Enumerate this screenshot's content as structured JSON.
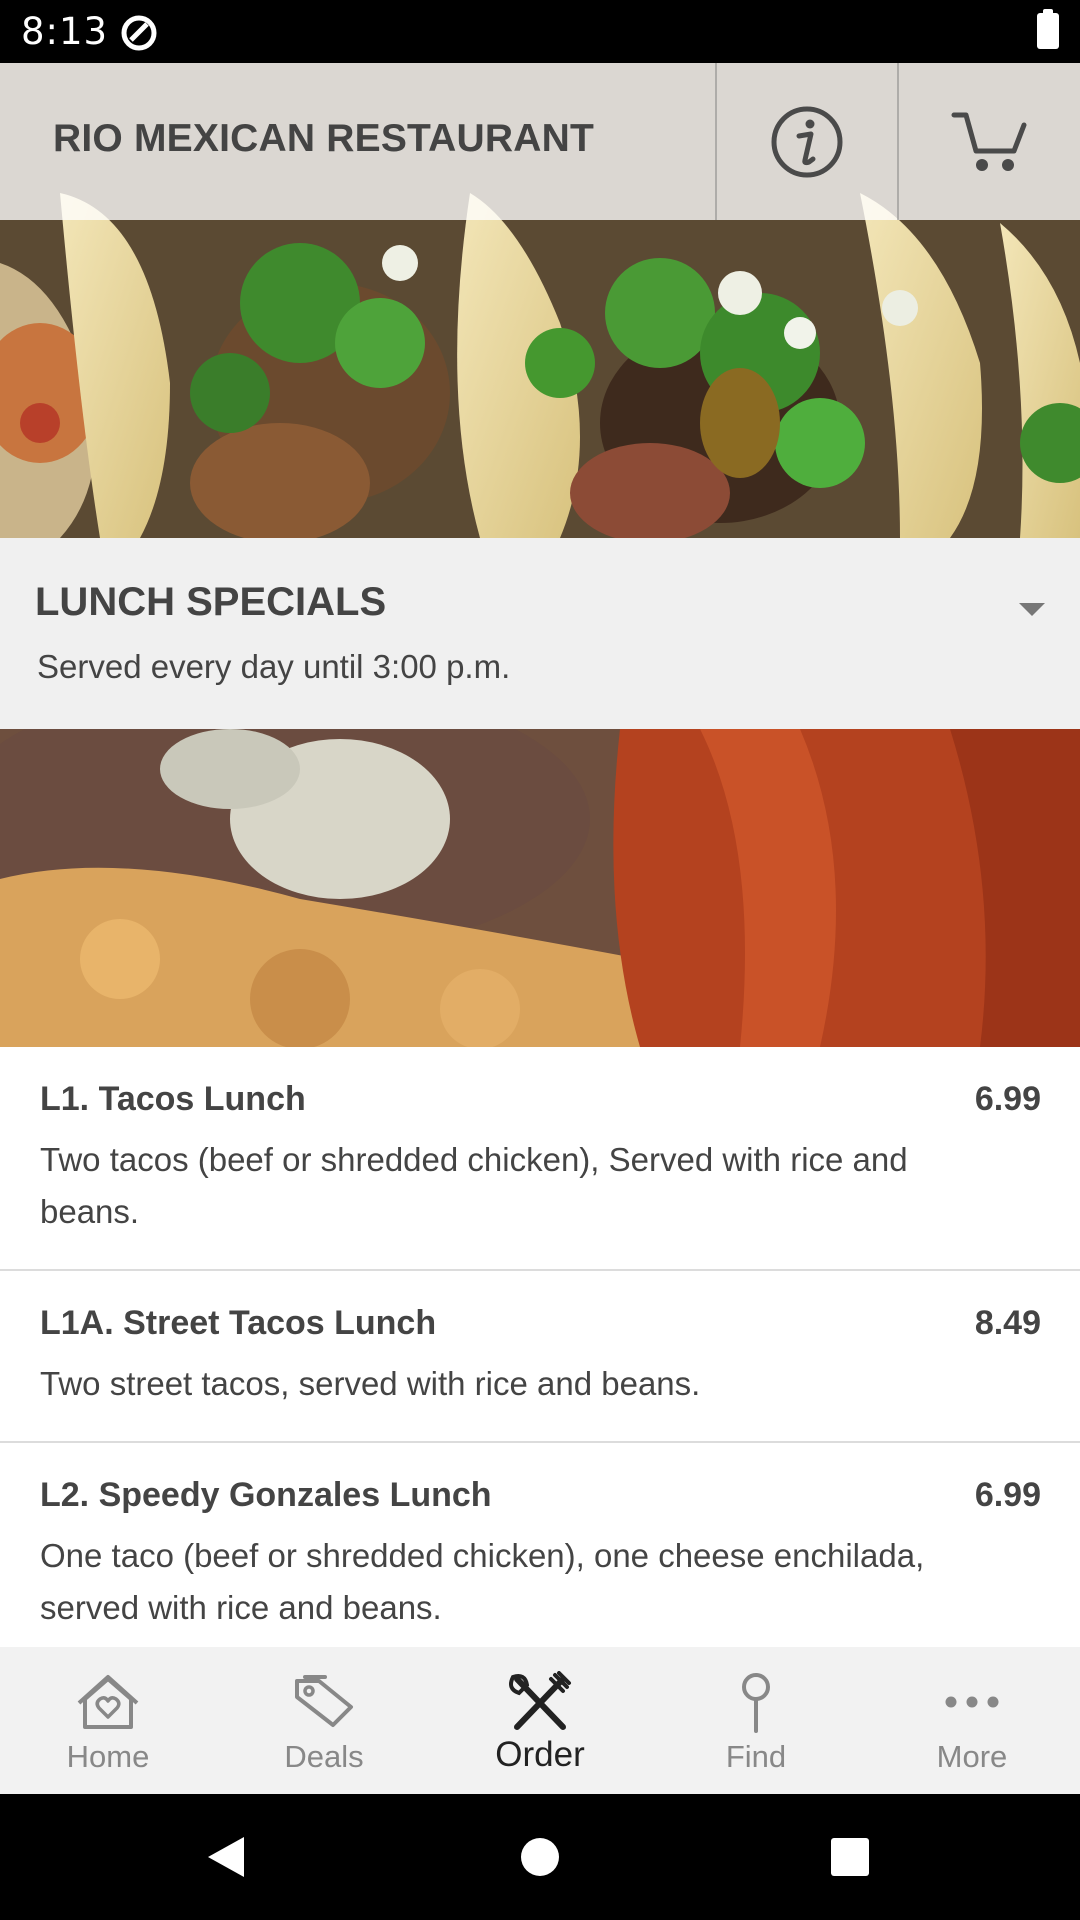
{
  "status_bar": {
    "time": "8:13"
  },
  "header": {
    "title": "RIO MEXICAN RESTAURANT",
    "info_icon": "info-icon",
    "cart_icon": "cart-icon"
  },
  "section": {
    "title": "LUNCH SPECIALS",
    "subtitle": "Served every day until 3:00 p.m.",
    "toggle_icon": "caret-down-icon"
  },
  "menu_items": [
    {
      "name": "L1. Tacos Lunch",
      "price": "6.99",
      "description": "Two tacos (beef or shredded chicken), Served with rice and beans."
    },
    {
      "name": "L1A. Street Tacos Lunch",
      "price": "8.49",
      "description": "Two street tacos, served with rice and beans."
    },
    {
      "name": "L2. Speedy Gonzales Lunch",
      "price": "6.99",
      "description": "One taco (beef or shredded chicken), one cheese enchilada, served with rice and beans."
    }
  ],
  "bottom_nav": [
    {
      "label": "Home",
      "icon": "home-heart-icon",
      "active": false
    },
    {
      "label": "Deals",
      "icon": "tags-icon",
      "active": false
    },
    {
      "label": "Order",
      "icon": "utensils-icon",
      "active": true
    },
    {
      "label": "Find",
      "icon": "map-pin-icon",
      "active": false
    },
    {
      "label": "More",
      "icon": "more-dots-icon",
      "active": false
    }
  ],
  "colors": {
    "text_primary": "#444444",
    "nav_inactive": "#888888",
    "nav_active": "#222222",
    "section_bg": "#f0f0f0",
    "divider": "#dcdcdc"
  }
}
